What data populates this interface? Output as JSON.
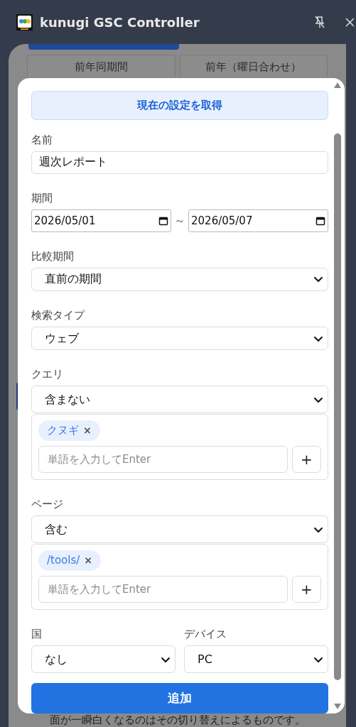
{
  "window": {
    "title": "kunugi GSC Controller"
  },
  "background": {
    "buttons": [
      {
        "label": "前年同期間"
      },
      {
        "label": "前年（曜日合わせ）"
      }
    ],
    "note": "面が一瞬白くなるのはその切り替えによるものです。"
  },
  "dialog": {
    "fetch_button": "現在の設定を取得",
    "name": {
      "label": "名前",
      "value": "週次レポート"
    },
    "period": {
      "label": "期間",
      "start": "2026/05/01",
      "separator": "～",
      "end": "2026/05/07"
    },
    "comparison": {
      "label": "比較期間",
      "value": "直前の期間"
    },
    "search_type": {
      "label": "検索タイプ",
      "value": "ウェブ"
    },
    "filters": [
      {
        "label": "クエリ",
        "match": "含まない",
        "tags": [
          {
            "text": "クヌギ",
            "remove": "×"
          }
        ],
        "placeholder": "単語を入力してEnter",
        "add": "+"
      },
      {
        "label": "ページ",
        "match": "含む",
        "tags": [
          {
            "text": "/tools/",
            "remove": "×"
          }
        ],
        "placeholder": "単語を入力してEnter",
        "add": "+"
      }
    ],
    "country": {
      "label": "国",
      "value": "なし"
    },
    "device": {
      "label": "デバイス",
      "value": "PC"
    },
    "submit": "追加"
  }
}
